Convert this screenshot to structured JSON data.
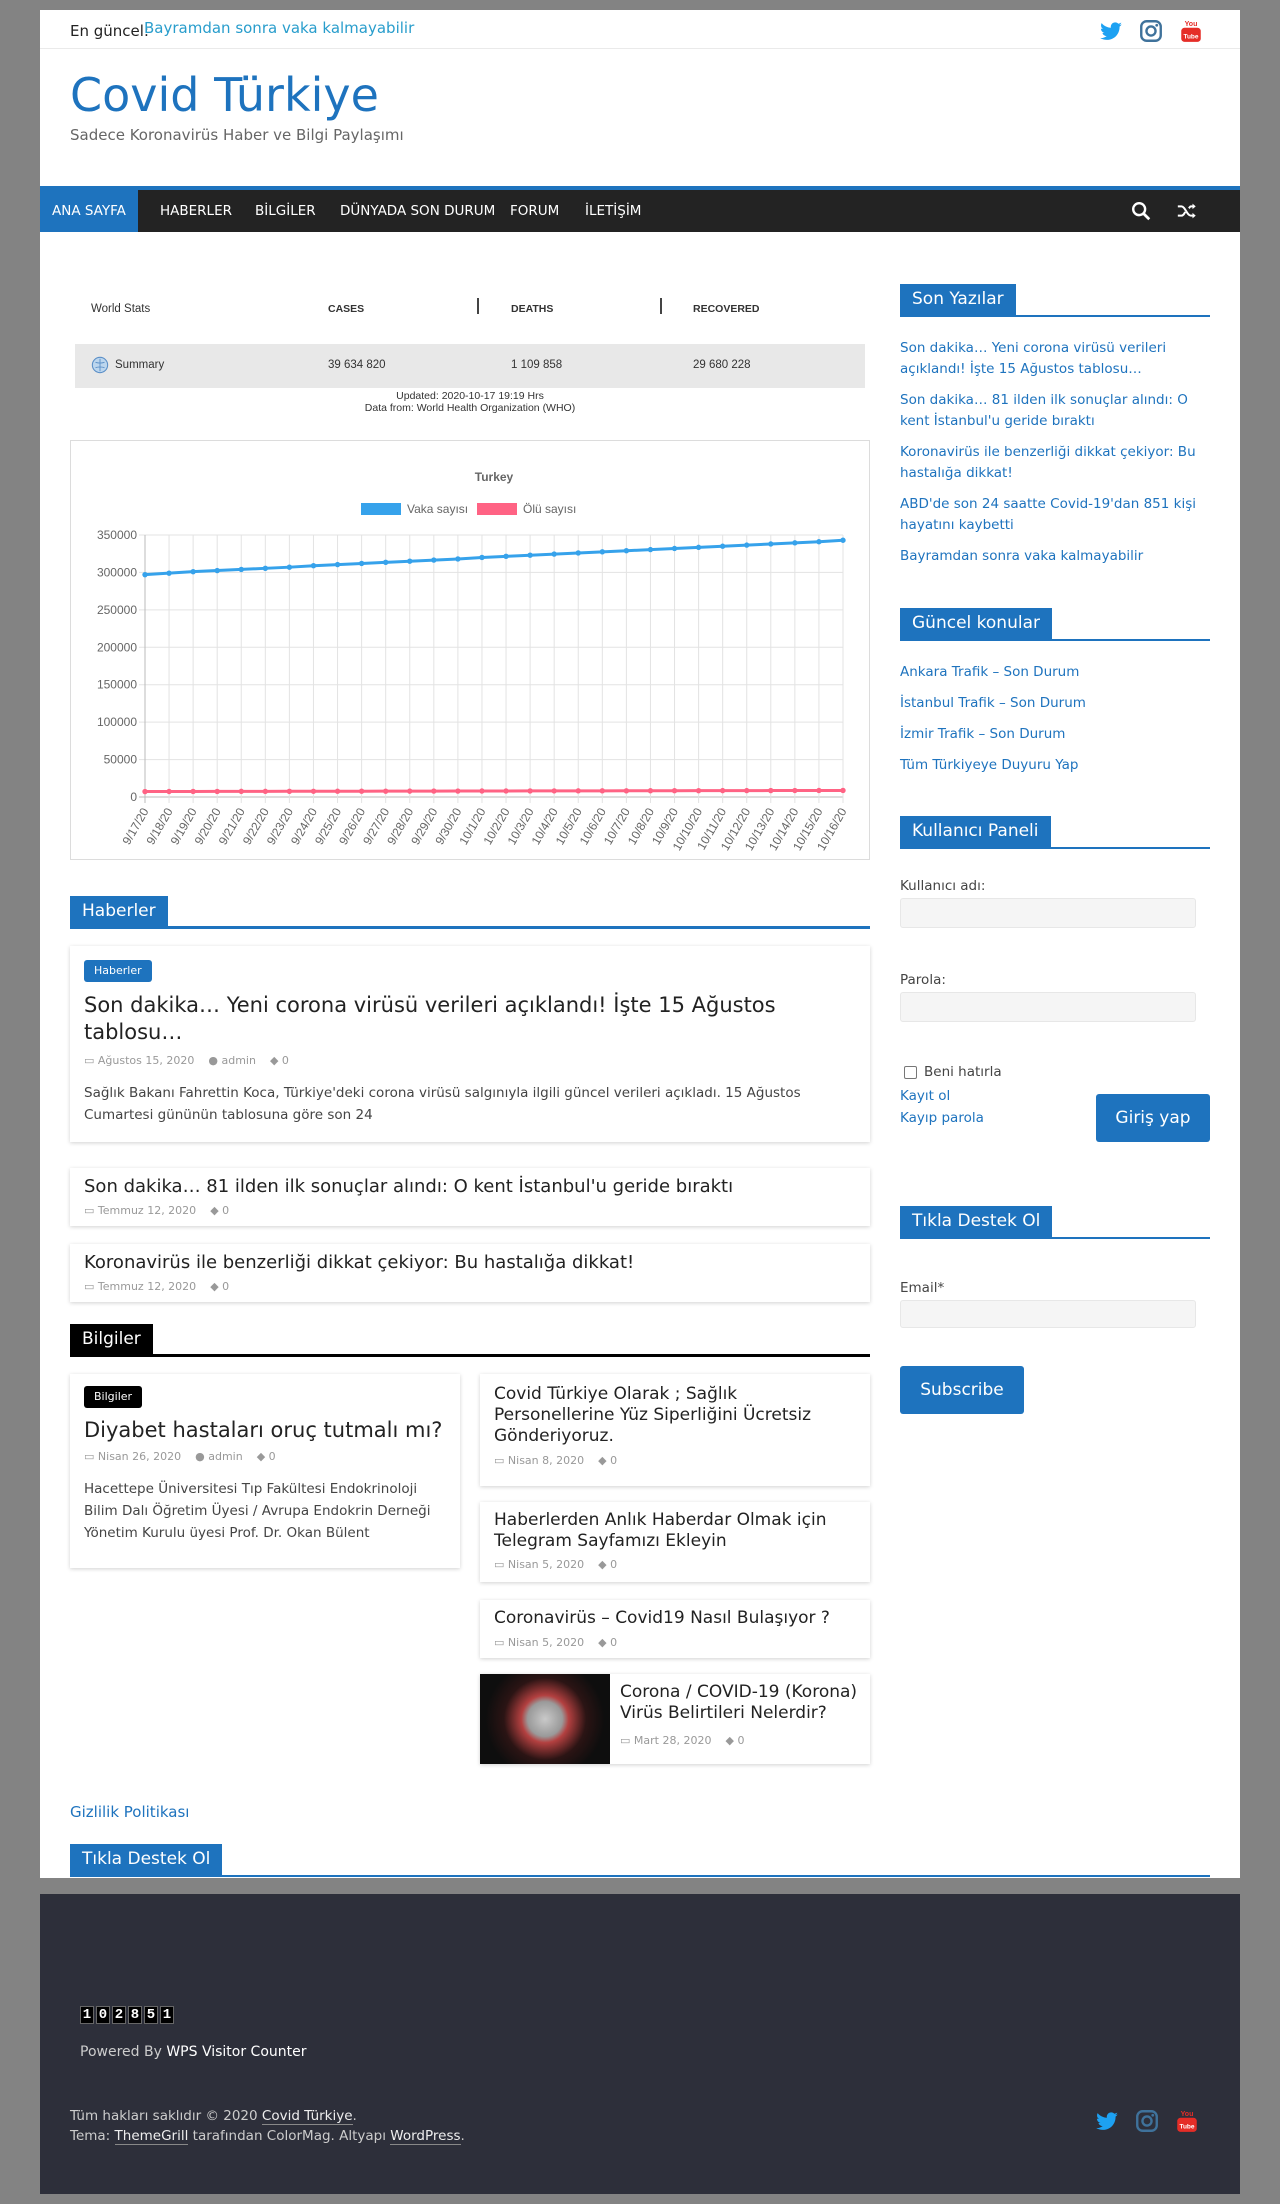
{
  "topbar": {
    "latest_label": "En güncel:",
    "latest_link": "Bayramdan sonra vaka kalmayabilir"
  },
  "site": {
    "title": "Covid Türkiye",
    "tagline": "Sadece Koronavirüs Haber ve Bilgi Paylaşımı"
  },
  "nav": {
    "items": [
      "ANA SAYFA",
      "HABERLER",
      "BİLGİLER",
      "DÜNYADA SON DURUM",
      "FORUM",
      "İLETİŞİM"
    ]
  },
  "stats": {
    "header": {
      "label": "World Stats",
      "cases": "CASES",
      "deaths": "DEATHS",
      "recovered": "RECOVERED"
    },
    "row": {
      "label": "Summary",
      "cases": "39 634 820",
      "deaths": "1 109 858",
      "recovered": "29 680 228"
    },
    "updated": "Updated:  2020-10-17 19:19 Hrs",
    "source": "Data from: World Health Organization (WHO)"
  },
  "chart_data": {
    "type": "line",
    "title": "Turkey",
    "categories": [
      "9/17/20",
      "9/18/20",
      "9/19/20",
      "9/20/20",
      "9/21/20",
      "9/22/20",
      "9/23/20",
      "9/24/20",
      "9/25/20",
      "9/26/20",
      "9/27/20",
      "9/28/20",
      "9/29/20",
      "9/30/20",
      "10/1/20",
      "10/2/20",
      "10/3/20",
      "10/4/20",
      "10/5/20",
      "10/6/20",
      "10/7/20",
      "10/8/20",
      "10/9/20",
      "10/10/20",
      "10/11/20",
      "10/12/20",
      "10/13/20",
      "10/14/20",
      "10/15/20",
      "10/16/20"
    ],
    "series": [
      {
        "name": "Vaka sayısı",
        "color": "#36a2eb",
        "values": [
          297000,
          299000,
          301000,
          302500,
          304000,
          305500,
          307000,
          309000,
          310500,
          312000,
          313500,
          315000,
          316500,
          318000,
          320000,
          321500,
          323000,
          324500,
          326000,
          327500,
          329000,
          330500,
          332000,
          333500,
          335000,
          336500,
          338000,
          339500,
          341000,
          343000
        ]
      },
      {
        "name": "Ölü sayısı",
        "color": "#ff6384",
        "values": [
          7300,
          7350,
          7400,
          7450,
          7500,
          7550,
          7600,
          7650,
          7700,
          7750,
          7800,
          7850,
          7900,
          7950,
          8000,
          8050,
          8100,
          8150,
          8200,
          8250,
          8300,
          8350,
          8400,
          8450,
          8500,
          8550,
          8600,
          8650,
          8700,
          8750
        ]
      }
    ],
    "ylim": [
      0,
      350000
    ],
    "yticks": [
      "350000",
      "300000",
      "250000",
      "200000",
      "150000",
      "100000",
      "50000",
      "0"
    ],
    "grid": true,
    "legend": "top"
  },
  "haberler": {
    "heading": "Haberler",
    "featured": {
      "tag": "Haberler",
      "title": "Son dakika… Yeni corona virüsü verileri açıklandı! İşte 15 Ağustos tablosu…",
      "date": "Ağustos 15, 2020",
      "author": "admin",
      "comments": "0",
      "excerpt": "Sağlık Bakanı Fahrettin Koca, Türkiye'deki corona virüsü salgınıyla ilgili güncel verileri açıkladı. 15 Ağustos Cumartesi gününün tablosuna göre son 24"
    },
    "list": [
      {
        "title": "Son dakika… 81 ilden ilk sonuçlar alındı: O kent İstanbul'u geride bıraktı",
        "date": "Temmuz 12, 2020",
        "comments": "0"
      },
      {
        "title": "Koronavirüs ile benzerliği dikkat çekiyor: Bu hastalığa dikkat!",
        "date": "Temmuz 12, 2020",
        "comments": "0"
      }
    ]
  },
  "bilgiler": {
    "heading": "Bilgiler",
    "featured": {
      "tag": "Bilgiler",
      "title": "Diyabet hastaları oruç tutmalı mı?",
      "date": "Nisan 26, 2020",
      "author": "admin",
      "comments": "0",
      "excerpt": "Hacettepe Üniversitesi Tıp Fakültesi Endokrinoloji Bilim Dalı Öğretim Üyesi / Avrupa Endokrin Derneği Yönetim Kurulu üyesi Prof. Dr. Okan Bülent"
    },
    "list": [
      {
        "title": "Covid Türkiye Olarak ; Sağlık Personellerine Yüz Siperliğini Ücretsiz Gönderiyoruz.",
        "date": "Nisan 8, 2020",
        "comments": "0"
      },
      {
        "title": "Haberlerden Anlık Haberdar Olmak için Telegram Sayfamızı Ekleyin",
        "date": "Nisan 5, 2020",
        "comments": "0"
      },
      {
        "title": "Coronavirüs – Covid19 Nasıl Bulaşıyor ?",
        "date": "Nisan 5, 2020",
        "comments": "0"
      },
      {
        "title": "Corona / COVID-19 (Korona) Virüs Belirtileri Nelerdir?",
        "date": "Mart 28, 2020",
        "comments": "0"
      }
    ]
  },
  "sidebar": {
    "recent": {
      "heading": "Son Yazılar",
      "items": [
        "Son dakika… Yeni corona virüsü verileri açıklandı! İşte 15 Ağustos tablosu…",
        "Son dakika… 81 ilden ilk sonuçlar alındı: O kent İstanbul'u geride bıraktı",
        "Koronavirüs ile benzerliği dikkat çekiyor: Bu hastalığa dikkat!",
        "ABD'de son 24 saatte Covid-19'dan 851 kişi hayatını kaybetti",
        "Bayramdan sonra vaka kalmayabilir"
      ]
    },
    "topics": {
      "heading": "Güncel konular",
      "items": [
        "Ankara Trafik – Son Durum",
        "İstanbul Trafik – Son Durum",
        "İzmir Trafik – Son Durum",
        "Tüm Türkiyeye Duyuru Yap"
      ]
    },
    "login": {
      "heading": "Kullanıcı Paneli",
      "username_label": "Kullanıcı adı:",
      "password_label": "Parola:",
      "remember": "Beni hatırla",
      "register": "Kayıt ol",
      "lost": "Kayıp parola",
      "submit": "Giriş yap"
    },
    "support": {
      "heading": "Tıkla Destek Ol",
      "email_label": "Email*",
      "submit": "Subscribe"
    }
  },
  "bottom": {
    "privacy": "Gizlilik Politikası",
    "support_heading": "Tıkla Destek Ol"
  },
  "footer": {
    "counter": "102851",
    "powered_prefix": "Powered By",
    "powered_link": "WPS Visitor Counter",
    "copyright_prefix": "Tüm hakları saklıdır © 2020",
    "copyright_link": "Covid Türkiye",
    "theme_prefix": "Tema:",
    "theme_link": "ThemeGrill",
    "theme_mid": "tarafından ColorMag. Altyapı",
    "wp_link": "WordPress"
  },
  "colors": {
    "brand": "#1e73be",
    "nav": "#232323",
    "footer": "#2d2f3a",
    "twitter": "#1da1f2",
    "instagram": "#3f729b",
    "youtube": "#e52d27"
  }
}
